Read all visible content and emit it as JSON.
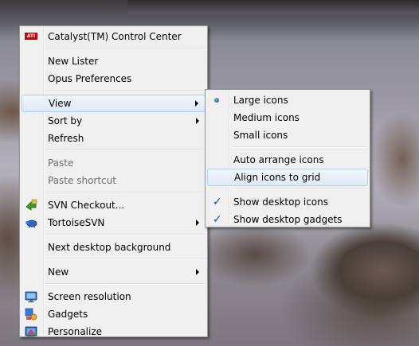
{
  "main_menu": {
    "catalyst": {
      "label": "Catalyst(TM) Control Center",
      "icon_text": "ATI"
    },
    "new_lister": "New Lister",
    "opus_prefs": "Opus Preferences",
    "view": "View",
    "sort_by": "Sort by",
    "refresh": "Refresh",
    "paste": "Paste",
    "paste_shortcut": "Paste shortcut",
    "svn_checkout": "SVN Checkout...",
    "tortoise_svn": "TortoiseSVN",
    "next_bg": "Next desktop background",
    "new": "New",
    "screen_res": "Screen resolution",
    "gadgets": "Gadgets",
    "personalize": "Personalize"
  },
  "view_submenu": {
    "large_icons": "Large icons",
    "medium_icons": "Medium icons",
    "small_icons": "Small icons",
    "auto_arrange": "Auto arrange icons",
    "align_grid": "Align icons to grid",
    "show_desktop_icons": "Show desktop icons",
    "show_gadgets": "Show desktop gadgets",
    "check_mark": "✓"
  },
  "icons": {
    "catalyst": "ati-logo-icon",
    "svn_checkout": "svn-checkout-icon",
    "tortoise": "tortoisesvn-icon",
    "screen_res": "monitor-icon",
    "gadgets": "gadgets-icon",
    "personalize": "personalize-icon"
  },
  "colors": {
    "menu_bg": "#f0f0f0",
    "hover_border": "#aecff7",
    "disabled_text": "#6d6d6d",
    "check": "#1f50a8"
  }
}
